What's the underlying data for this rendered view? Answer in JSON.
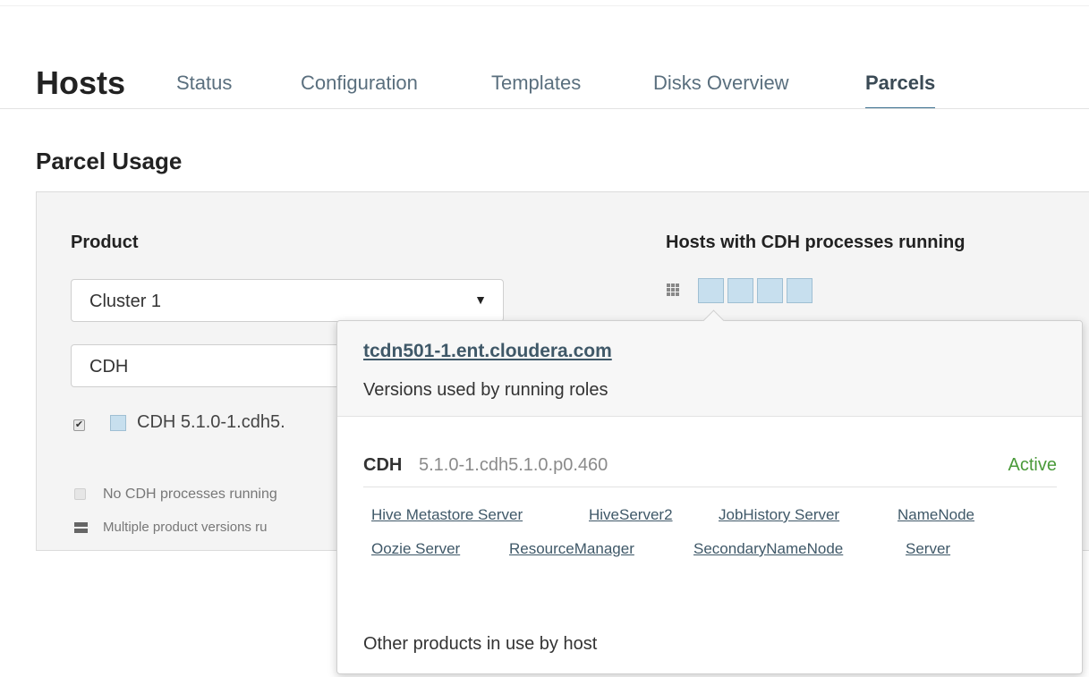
{
  "header": {
    "title": "Hosts",
    "tabs": [
      "Status",
      "Configuration",
      "Templates",
      "Disks Overview",
      "Parcels"
    ],
    "active_tab": "Parcels"
  },
  "section_title": "Parcel Usage",
  "product": {
    "label": "Product",
    "cluster_select": "Cluster 1",
    "product_select": "CDH",
    "parcel_item": "CDH 5.1.0-1.cdh5.",
    "parcel_checked": true
  },
  "hosts": {
    "label": "Hosts with CDH processes running",
    "count": 4
  },
  "legend": {
    "no_processes": "No CDH processes running",
    "multiple_versions": "Multiple product versions ru"
  },
  "popover": {
    "host": "tcdn501-1.ent.cloudera.com",
    "subtitle": "Versions used by running roles",
    "parcel_name": "CDH",
    "parcel_version": "5.1.0-1.cdh5.1.0.p0.460",
    "parcel_status": "Active",
    "roles_row1": [
      "Hive Metastore Server",
      "HiveServer2",
      "JobHistory Server",
      "NameNode"
    ],
    "roles_row2": [
      "Oozie Server",
      "ResourceManager",
      "SecondaryNameNode",
      "Server"
    ],
    "footer": "Other products in use by host"
  },
  "colors": {
    "host_box": "#c7dfee",
    "active_status": "#4a9a3a",
    "link": "#3f5868"
  }
}
